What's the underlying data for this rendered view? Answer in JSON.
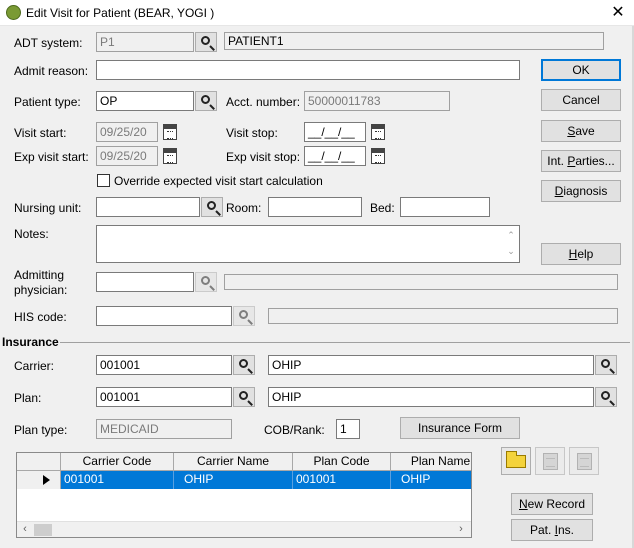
{
  "window": {
    "title": "Edit Visit for Patient (BEAR, YOGI )",
    "icon": "app-globe-icon",
    "close_glyph": "✕"
  },
  "form": {
    "adt_system": {
      "label": "ADT system:",
      "value": "P1",
      "description": "PATIENT1"
    },
    "admit_reason": {
      "label": "Admit reason:",
      "value": ""
    },
    "patient_type": {
      "label": "Patient type:",
      "value": "OP"
    },
    "acct_number": {
      "label": "Acct. number:",
      "value": "50000011783"
    },
    "visit_start": {
      "label": "Visit start:",
      "value": "09/25/20"
    },
    "visit_stop": {
      "label": "Visit stop:",
      "value": "__/__/__"
    },
    "exp_visit_start": {
      "label": "Exp visit start:",
      "value": "09/25/20"
    },
    "exp_visit_stop": {
      "label": "Exp visit stop:",
      "value": "__/__/__"
    },
    "override_checkbox": {
      "label": "Override expected visit start calculation",
      "checked": false
    },
    "nursing_unit": {
      "label": "Nursing unit:",
      "value": ""
    },
    "room": {
      "label": "Room:",
      "value": ""
    },
    "bed": {
      "label": "Bed:",
      "value": ""
    },
    "notes": {
      "label": "Notes:",
      "value": ""
    },
    "admitting_physician": {
      "label_line1": "Admitting",
      "label_line2": "physician:",
      "value": ""
    },
    "his_code": {
      "label": "HIS code:",
      "value": ""
    }
  },
  "buttons": {
    "ok": "OK",
    "cancel": "Cancel",
    "save_u": "S",
    "save_rest": "ave",
    "int_parties_pre": "Int. ",
    "int_parties_u": "P",
    "int_parties_rest": "arties...",
    "diagnosis_u": "D",
    "diagnosis_rest": "iagnosis",
    "help_u": "H",
    "help_rest": "elp",
    "insurance_form": "Insurance Form",
    "new_record_u": "N",
    "new_record_rest": "ew Record",
    "pat_ins_pre": "Pat. ",
    "pat_ins_u": "I",
    "pat_ins_rest": "ns."
  },
  "insurance": {
    "section_label": "Insurance",
    "carrier": {
      "label": "Carrier:",
      "code": "001001",
      "name": "OHIP"
    },
    "plan": {
      "label": "Plan:",
      "code": "001001",
      "name": "OHIP"
    },
    "plan_type": {
      "label": "Plan type:",
      "value": "MEDICAID"
    },
    "cob_rank": {
      "label": "COB/Rank:",
      "value": "1"
    },
    "grid": {
      "columns": [
        "Carrier Code",
        "Carrier Name",
        "Plan Code",
        "Plan Name"
      ],
      "rows": [
        [
          "001001",
          "OHIP",
          "001001",
          "OHIP"
        ]
      ],
      "scroll_left": "‹",
      "scroll_right": "›"
    }
  },
  "notes_scroll": {
    "up": "⌃",
    "down": "⌄"
  }
}
